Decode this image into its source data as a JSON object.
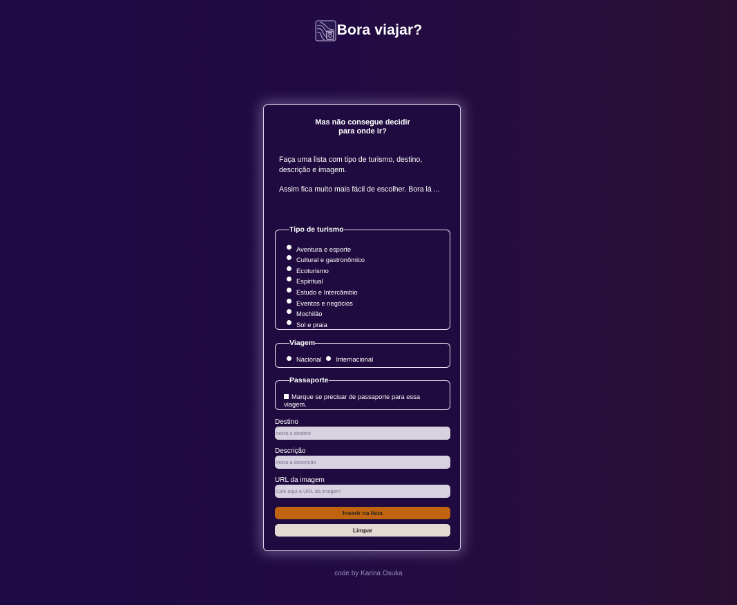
{
  "header": {
    "logo_icon": "travel-map-icon",
    "title": "Bora viajar?"
  },
  "card": {
    "title": "Mas não consegue decidir\npara onde ir?",
    "intro_1": "Faça uma lista com tipo de turismo, destino, descrição e imagem.",
    "intro_2": "Assim fica muito mais fácil de escolher. Bora lá ...",
    "tourism": {
      "legend": "Tipo de turismo",
      "options": [
        "Aventura e esporte",
        "Cultural e gastronômico",
        "Ecoturismo",
        "Espiritual",
        "Estudo e Intercâmbio",
        "Eventos e negócios",
        "Mochilão",
        "Sol e praia"
      ]
    },
    "trip": {
      "legend": "Viagem",
      "options": [
        "Nacional",
        "Internacional"
      ]
    },
    "passport": {
      "legend": "Passaporte",
      "checkbox_label": "Marque se precisar de passaporte para essa viagem."
    },
    "destination": {
      "label": "Destino",
      "placeholder": "Insira o destino"
    },
    "description": {
      "label": "Descrição",
      "placeholder": "Insira a descrição"
    },
    "image_url": {
      "label": "URL da imagem",
      "placeholder": "Cole aqui a URL da imagem"
    },
    "insert_button": "Inserir na lista",
    "clear_button": "Limpar"
  },
  "footer": {
    "credit": "code by Karina Osuka"
  },
  "colors": {
    "accent_button": "#c0640f",
    "clear_button": "#e5d9d3",
    "input_background": "#d7d1e0",
    "page_background": "#200a44"
  }
}
